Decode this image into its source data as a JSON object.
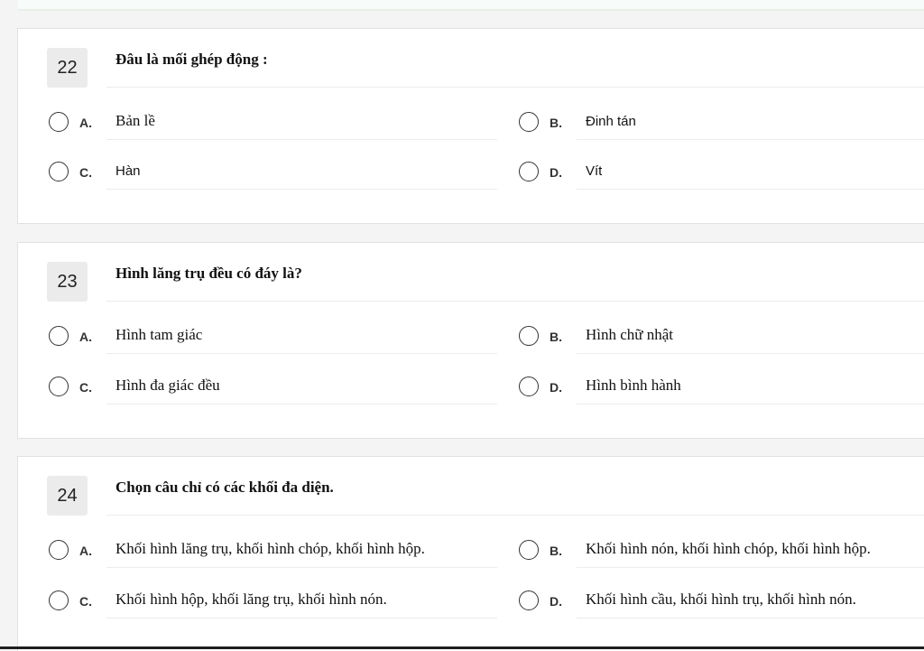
{
  "questions": [
    {
      "number": "22",
      "text": "Đâu là mối ghép động :",
      "options": [
        {
          "letter": "A.",
          "text": "Bản lề"
        },
        {
          "letter": "B.",
          "text": "Đinh tán"
        },
        {
          "letter": "C.",
          "text": "Hàn"
        },
        {
          "letter": "D.",
          "text": "Vít"
        }
      ]
    },
    {
      "number": "23",
      "text": "Hình lăng trụ đều có đáy là?",
      "options": [
        {
          "letter": "A.",
          "text": "Hình tam giác"
        },
        {
          "letter": "B.",
          "text": "Hình chữ nhật"
        },
        {
          "letter": "C.",
          "text": "Hình đa giác đều"
        },
        {
          "letter": "D.",
          "text": "Hình bình hành"
        }
      ]
    },
    {
      "number": "24",
      "text": "Chọn câu chỉ có các khối đa diện.",
      "options": [
        {
          "letter": "A.",
          "text": "Khối hình lăng trụ, khối hình chóp, khối hình hộp."
        },
        {
          "letter": "B.",
          "text": "Khối hình nón, khối hình chóp, khối hình hộp."
        },
        {
          "letter": "C.",
          "text": "Khối hình hộp, khối lăng trụ, khối hình nón."
        },
        {
          "letter": "D.",
          "text": "Khối hình cầu, khối hình trụ, khối hình nón."
        }
      ]
    }
  ]
}
